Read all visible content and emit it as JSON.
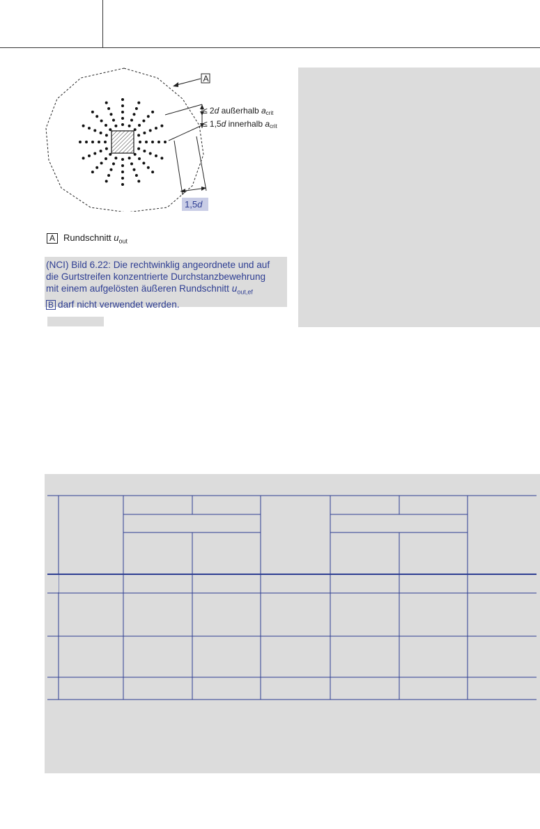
{
  "figure": {
    "callout_label": "A",
    "dim_upper": {
      "prefix": "≤ 2",
      "var": "d",
      "suffix": " außerhalb ",
      "avar": "a",
      "asub": "crit"
    },
    "dim_lower": {
      "prefix": "≤ 1,5",
      "var": "d",
      "suffix": " innerhalb ",
      "avar": "a",
      "asub": "crit"
    },
    "dim_bottom": {
      "prefix": "1,5",
      "var": "d"
    }
  },
  "legend": {
    "label": "A",
    "text": "Rundschnitt ",
    "var": "u",
    "sub": "out"
  },
  "nci": {
    "line1": "(NCI) Bild 6.22: Die rechtwinklig angeordnete und auf",
    "line2": "die Gurtstreifen konzentrierte Durchstanzbewehrung",
    "line3_pre": "mit einem aufgelösten äußeren Rundschnitt ",
    "line3_var": "u",
    "line3_sub": "out,ef",
    "line4_box": "B",
    "line4_text": "darf nicht verwendet werden."
  },
  "colors": {
    "accent_blue": "#2d3d92",
    "panel_gray": "#dcdcdc",
    "dim_fill": "#c9cde6"
  }
}
